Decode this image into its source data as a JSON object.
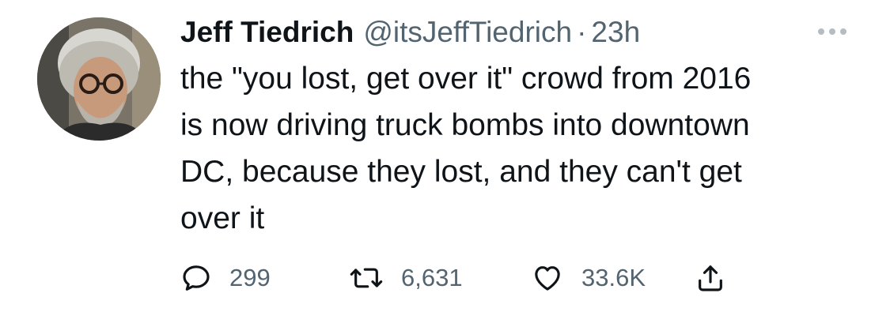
{
  "tweet": {
    "author_name": "Jeff Tiedrich",
    "author_handle": "@itsJeffTiedrich",
    "separator": "·",
    "timestamp": "23h",
    "text": "the \"you lost, get over it\" crowd from 2016\nis now driving truck bombs into downtown\nDC, because they lost, and they can't get\nover it",
    "avatar_icon": "profile-photo",
    "more_icon": "ellipsis-icon"
  },
  "actions": {
    "reply": {
      "icon": "reply-icon",
      "count": "299"
    },
    "retweet": {
      "icon": "retweet-icon",
      "count": "6,631"
    },
    "like": {
      "icon": "heart-icon",
      "count": "33.6K"
    },
    "share": {
      "icon": "share-icon",
      "count": ""
    }
  },
  "colors": {
    "text": "#0f1419",
    "secondary": "#536471",
    "more_dots": "#b5bcc2",
    "background": "#ffffff"
  }
}
